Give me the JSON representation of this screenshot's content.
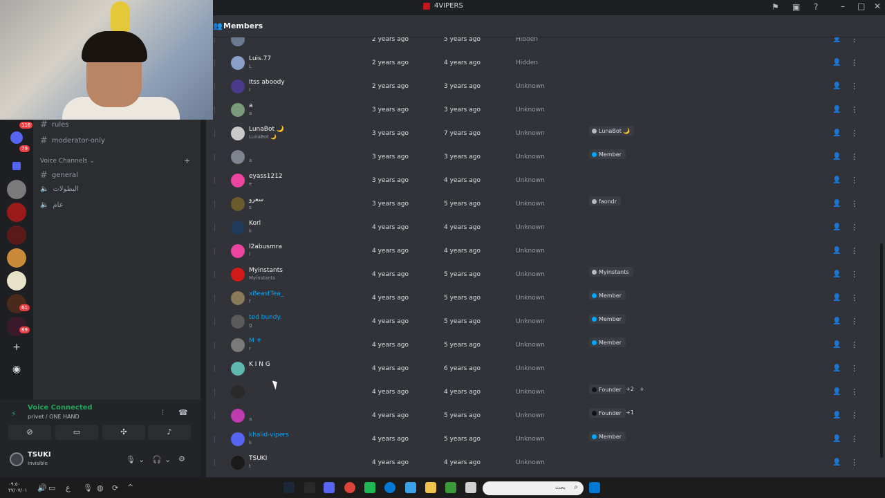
{
  "titlebar": {
    "title": "4VIPERS"
  },
  "rail": {
    "badges": [
      "116",
      "79",
      "61",
      "89"
    ]
  },
  "sidebar": {
    "channels_text": [
      {
        "name": "rules"
      },
      {
        "name": "moderator-only"
      }
    ],
    "voice_category": "Voice Channels",
    "channels_voice": [
      {
        "name": "general",
        "type": "text"
      },
      {
        "name": "البطولات",
        "type": "voice"
      },
      {
        "name": "عام",
        "type": "voice"
      }
    ]
  },
  "voice_panel": {
    "status": "Voice Connected",
    "location": "privet / ONE HAND"
  },
  "user": {
    "name": "TSUKI",
    "status": "Invisible"
  },
  "main": {
    "title": "Members"
  },
  "members": [
    {
      "name": "",
      "sub": "",
      "joined_server": "2 years ago",
      "joined_discord": "5 years ago",
      "method": "Hidden",
      "avatar": "#6c7a91",
      "link": false,
      "roles": []
    },
    {
      "name": "Luis.77",
      "sub": "L",
      "joined_server": "2 years ago",
      "joined_discord": "4 years ago",
      "method": "Hidden",
      "avatar": "#8aa0c8",
      "link": false,
      "roles": []
    },
    {
      "name": "Itss aboody",
      "sub": "I",
      "joined_server": "2 years ago",
      "joined_discord": "3 years ago",
      "method": "Unknown",
      "avatar": "#4a3a8a",
      "link": false,
      "roles": []
    },
    {
      "name": "a",
      "sub": "a",
      "joined_server": "3 years ago",
      "joined_discord": "3 years ago",
      "method": "Unknown",
      "avatar": "#7a9a7a",
      "link": false,
      "roles": []
    },
    {
      "name": "LunaBot 🌙",
      "sub": "LunaBot 🌙",
      "joined_server": "3 years ago",
      "joined_discord": "7 years ago",
      "method": "Unknown",
      "avatar": "#c9c9c9",
      "link": false,
      "roles": [
        {
          "label": "LunaBot 🌙",
          "color": "#b5bac1"
        }
      ]
    },
    {
      "name": "",
      "sub": "a",
      "joined_server": "3 years ago",
      "joined_discord": "3 years ago",
      "method": "Unknown",
      "avatar": "#80848e",
      "link": true,
      "roles": [
        {
          "label": "Member",
          "color": "#00a8fc"
        }
      ]
    },
    {
      "name": "eyass1212",
      "sub": "e",
      "joined_server": "3 years ago",
      "joined_discord": "4 years ago",
      "method": "Unknown",
      "avatar": "#eb459e",
      "link": false,
      "roles": []
    },
    {
      "name": "سعرو",
      "sub": "s",
      "joined_server": "3 years ago",
      "joined_discord": "5 years ago",
      "method": "Unknown",
      "avatar": "#6b5a2a",
      "link": false,
      "roles": [
        {
          "label": "faondr",
          "color": "#b5bac1"
        }
      ]
    },
    {
      "name": "Korl",
      "sub": "k",
      "joined_server": "4 years ago",
      "joined_discord": "4 years ago",
      "method": "Unknown",
      "avatar": "#1f3b5a",
      "link": false,
      "roles": []
    },
    {
      "name": "l2abusmra",
      "sub": "l",
      "joined_server": "4 years ago",
      "joined_discord": "4 years ago",
      "method": "Unknown",
      "avatar": "#eb459e",
      "link": false,
      "roles": []
    },
    {
      "name": "Myinstants",
      "sub": "Myinstants",
      "joined_server": "4 years ago",
      "joined_discord": "5 years ago",
      "method": "Unknown",
      "avatar": "#d11a1a",
      "link": false,
      "roles": [
        {
          "label": "Myinstants",
          "color": "#b5bac1"
        }
      ]
    },
    {
      "name": "xBeastTea_",
      "sub": "f",
      "joined_server": "4 years ago",
      "joined_discord": "5 years ago",
      "method": "Unknown",
      "avatar": "#8a7a5a",
      "link": true,
      "roles": [
        {
          "label": "Member",
          "color": "#00a8fc"
        }
      ]
    },
    {
      "name": "ted bundy.",
      "sub": "g",
      "joined_server": "4 years ago",
      "joined_discord": "5 years ago",
      "method": "Unknown",
      "avatar": "#5a5a5a",
      "link": true,
      "roles": [
        {
          "label": "Member",
          "color": "#00a8fc"
        }
      ]
    },
    {
      "name": "M ⚜",
      "sub": "r",
      "joined_server": "4 years ago",
      "joined_discord": "5 years ago",
      "method": "Unknown",
      "avatar": "#7a7a7a",
      "link": true,
      "roles": [
        {
          "label": "Member",
          "color": "#00a8fc"
        }
      ]
    },
    {
      "name": "K I N G",
      "sub": "",
      "joined_server": "4 years ago",
      "joined_discord": "6 years ago",
      "method": "Unknown",
      "avatar": "#5fb8b0",
      "link": false,
      "roles": []
    },
    {
      "name": "",
      "sub": "",
      "joined_server": "4 years ago",
      "joined_discord": "4 years ago",
      "method": "Unknown",
      "avatar": "#2a2a2a",
      "link": false,
      "roles": [
        {
          "label": "Founder",
          "color": "#111214"
        }
      ],
      "extra": "+2",
      "add": "+"
    },
    {
      "name": "",
      "sub": "a",
      "joined_server": "4 years ago",
      "joined_discord": "5 years ago",
      "method": "Unknown",
      "avatar": "#c03ab0",
      "link": false,
      "roles": [
        {
          "label": "Founder",
          "color": "#111214"
        }
      ],
      "extra": "+1"
    },
    {
      "name": "khalid-vipers",
      "sub": "k",
      "joined_server": "4 years ago",
      "joined_discord": "5 years ago",
      "method": "Unknown",
      "avatar": "#5865f2",
      "link": true,
      "roles": [
        {
          "label": "Member",
          "color": "#00a8fc"
        }
      ]
    },
    {
      "name": "TSUKI",
      "sub": "t",
      "joined_server": "4 years ago",
      "joined_discord": "4 years ago",
      "method": "Unknown",
      "avatar": "#1a1a1a",
      "link": false,
      "roles": []
    }
  ],
  "taskbar": {
    "clock": "٠٩:٥٠\n٢٧/٠٧/٠١",
    "lang": "ع",
    "search_placeholder": "بحث"
  },
  "colors": {
    "green": "#23a55a",
    "blurple": "#5865f2",
    "link": "#00a8fc"
  }
}
